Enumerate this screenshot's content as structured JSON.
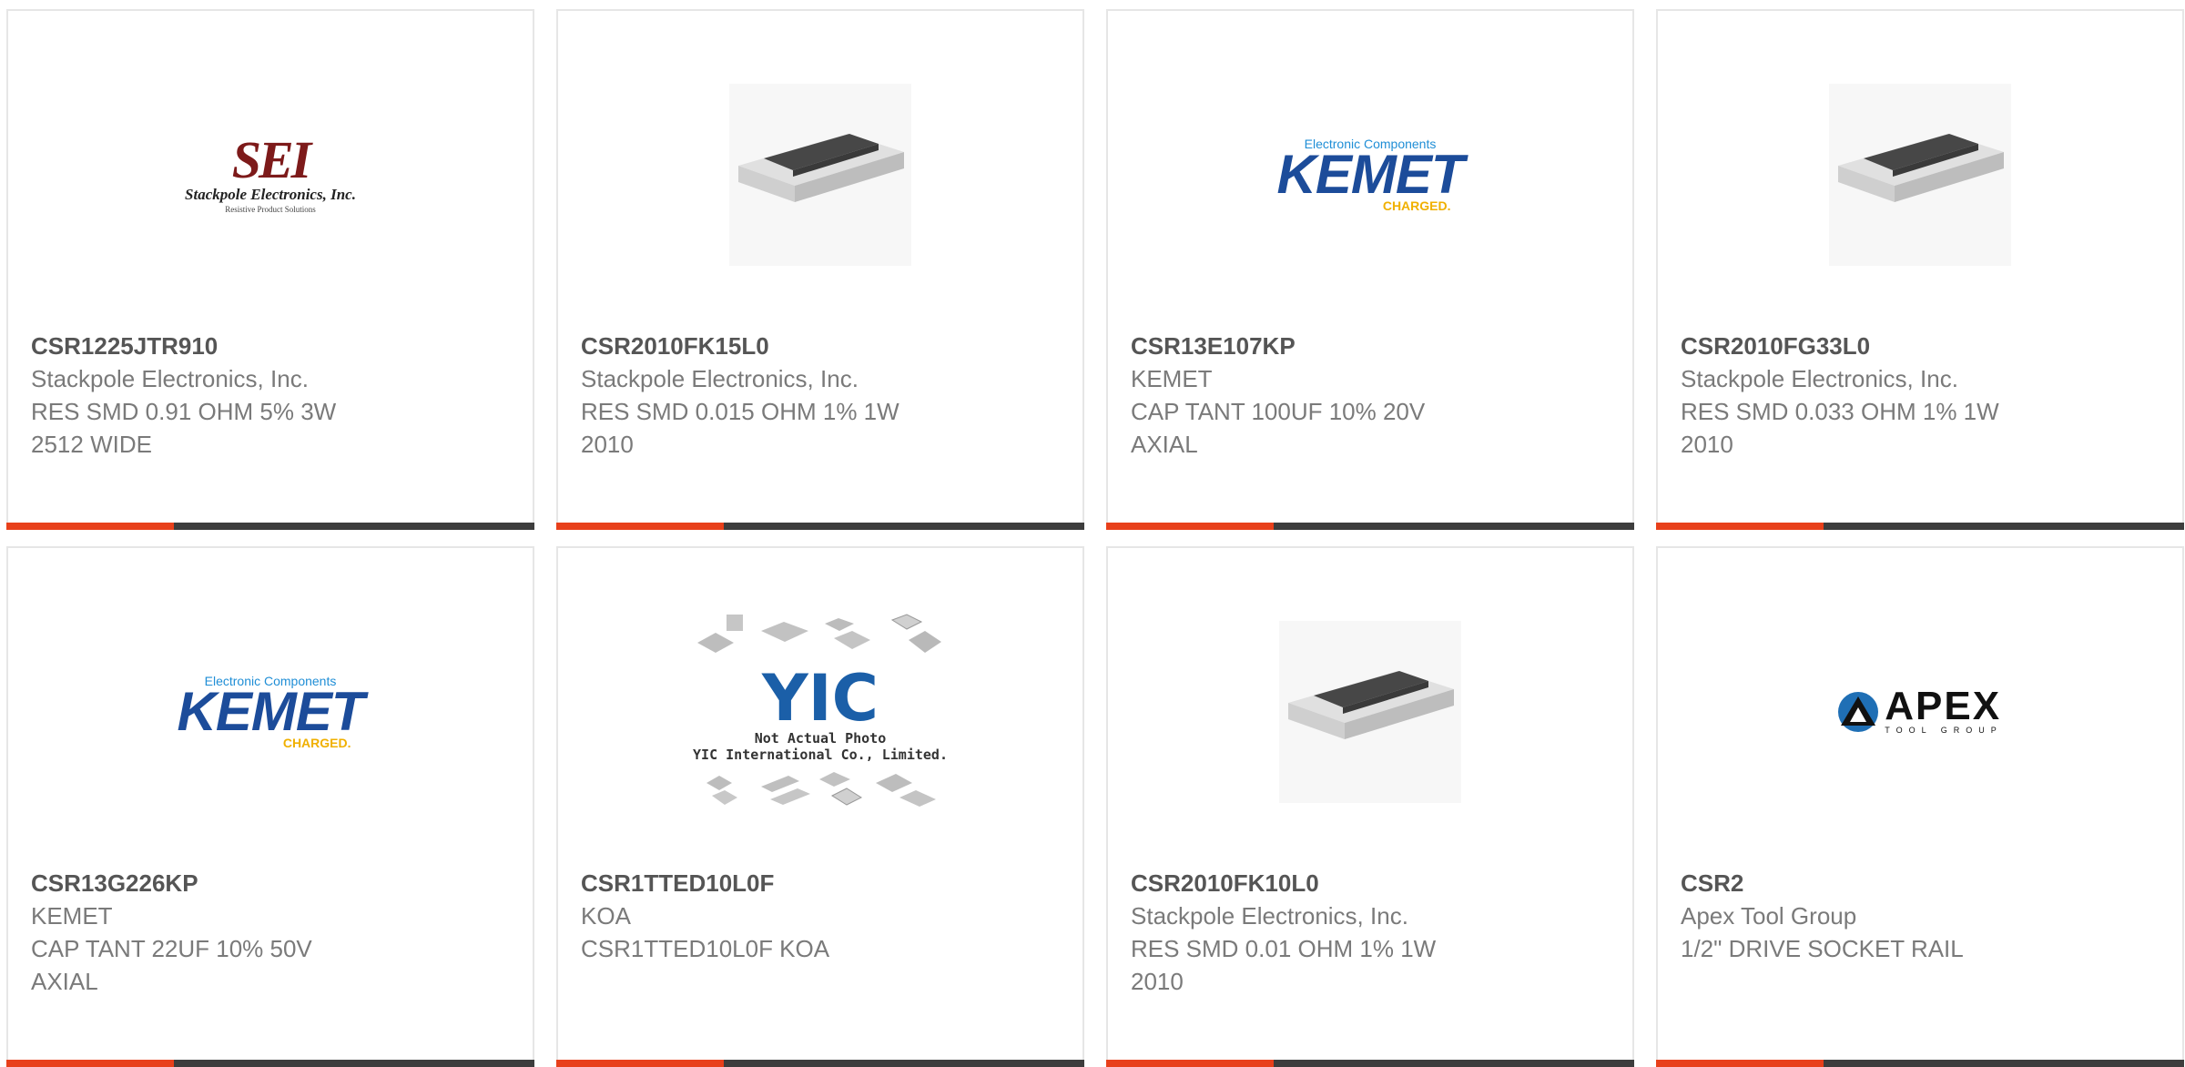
{
  "cards": [
    {
      "part_number": "CSR1225JTR910",
      "manufacturer": "Stackpole Electronics, Inc.",
      "description_1": "RES SMD 0.91 OHM 5% 3W",
      "description_2": "2512 WIDE",
      "image": "sei-logo",
      "logo_text": {
        "big": "SEI",
        "mid": "Stackpole Electronics, Inc.",
        "small": "Resistive Product Solutions"
      }
    },
    {
      "part_number": "CSR2010FK15L0",
      "manufacturer": "Stackpole Electronics, Inc.",
      "description_1": "RES SMD 0.015 OHM 1% 1W",
      "description_2": "2010",
      "image": "smd-resistor-photo"
    },
    {
      "part_number": "CSR13E107KP",
      "manufacturer": "KEMET",
      "description_1": "CAP TANT 100UF 10% 20V",
      "description_2": "AXIAL",
      "image": "kemet-logo",
      "logo_text": {
        "top": "Electronic Components",
        "main": "KEMET",
        "bottom": "CHARGED."
      }
    },
    {
      "part_number": "CSR2010FG33L0",
      "manufacturer": "Stackpole Electronics, Inc.",
      "description_1": "RES SMD 0.033 OHM 1% 1W",
      "description_2": "2010",
      "image": "smd-resistor-photo"
    },
    {
      "part_number": "CSR13G226KP",
      "manufacturer": "KEMET",
      "description_1": "CAP TANT 22UF 10% 50V",
      "description_2": "AXIAL",
      "image": "kemet-logo",
      "logo_text": {
        "top": "Electronic Components",
        "main": "KEMET",
        "bottom": "CHARGED."
      }
    },
    {
      "part_number": "CSR1TTED10L0F",
      "manufacturer": "KOA",
      "description_1": "CSR1TTED10L0F KOA",
      "description_2": "",
      "image": "not-actual-photo-placeholder",
      "logo_text": {
        "letters": "YIC",
        "note_1": "Not Actual Photo",
        "note_2": "YIC International Co., Limited."
      }
    },
    {
      "part_number": "CSR2010FK10L0",
      "manufacturer": "Stackpole Electronics, Inc.",
      "description_1": "RES SMD 0.01 OHM 1% 1W",
      "description_2": "2010",
      "image": "smd-resistor-photo"
    },
    {
      "part_number": "CSR2",
      "manufacturer": "Apex Tool Group",
      "description_1": "1/2\" DRIVE SOCKET RAIL",
      "description_2": "",
      "image": "apex-logo",
      "logo_text": {
        "main": "APEX",
        "sub": "TOOL GROUP"
      }
    }
  ],
  "colors": {
    "accent_bar": "#e8401b",
    "dark_bar": "#3d3d3d",
    "card_border": "#e6e6e6",
    "part_number_text": "#555555",
    "body_text": "#7a7a7a"
  }
}
